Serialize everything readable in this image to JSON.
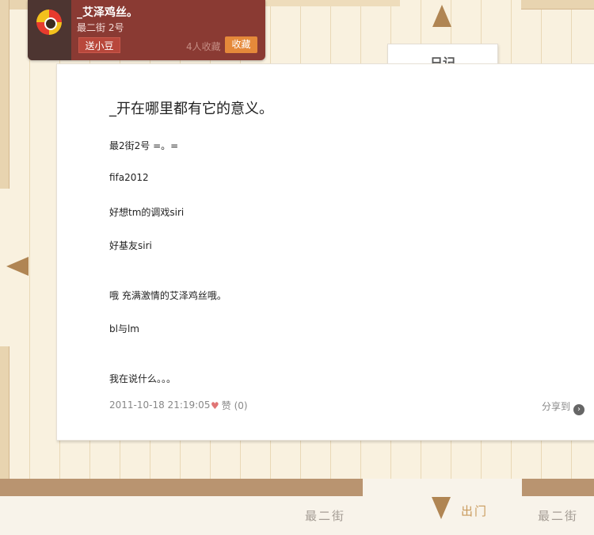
{
  "profile": {
    "name": "_艾泽鸡丝。",
    "address": "最二街 2号",
    "gift_button": "送小豆",
    "fav_count": "4人收藏",
    "fav_button": "收藏"
  },
  "tab": {
    "label": "日记"
  },
  "post": {
    "title": "_开在哪里都有它的意义。",
    "lines": [
      "最2街2号 =。=",
      "fifa2012",
      "好想tm的调戏siri",
      "好基友siri",
      "哦 充满激情的艾泽鸡丝哦。",
      "bl与lm",
      "我在说什么。。。"
    ],
    "date": "2011-10-18 21:19:05",
    "like_label": "赞 (0)",
    "share_label": "分享到"
  },
  "nav": {
    "street_left": "最二街",
    "street_right": "最二街",
    "exit": "出门"
  },
  "icons": {
    "up": "arrow-up-icon",
    "left": "arrow-left-icon",
    "down": "arrow-down-icon",
    "heart": "heart-icon",
    "share": "chevron-right-icon"
  },
  "colors": {
    "profile_bg": "#8a3a33",
    "fav_button": "#e5893a",
    "arrow": "#b08553"
  }
}
